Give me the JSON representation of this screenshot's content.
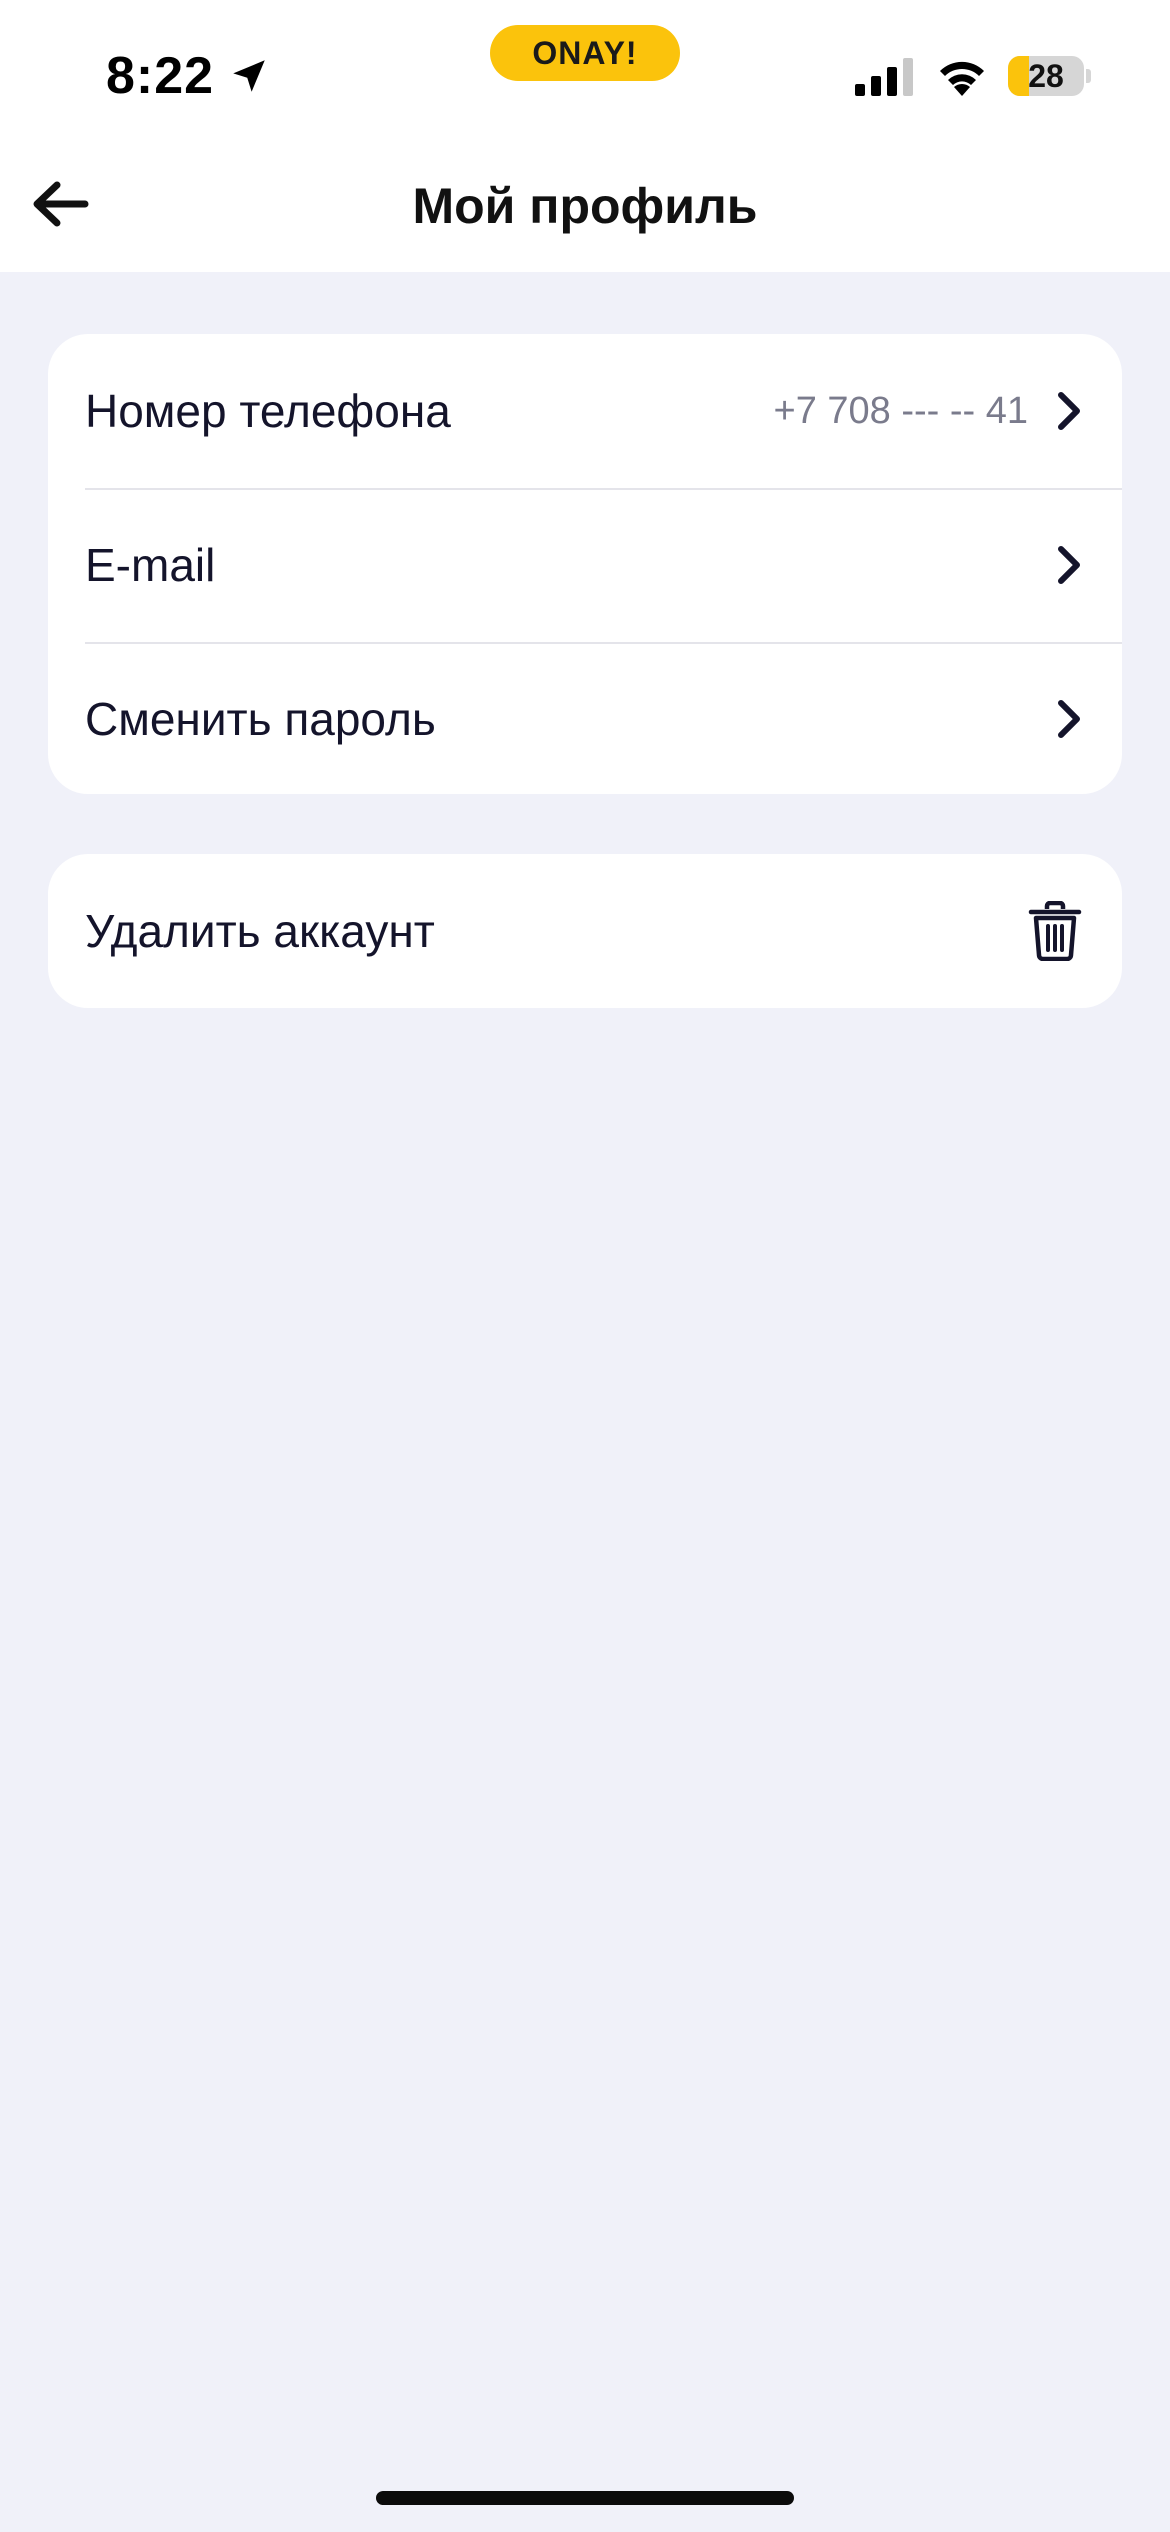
{
  "status_bar": {
    "time": "8:22",
    "location_icon": "location-arrow-icon",
    "pill_label": "ONAY!",
    "pill_color": "#fbc30c",
    "signal_icon": "cellular-signal-icon",
    "signal_bars_filled": 3,
    "signal_bars_total": 4,
    "wifi_icon": "wifi-icon",
    "battery_percent": "28",
    "battery_level": 0.28
  },
  "nav": {
    "back_icon": "arrow-left-icon",
    "title": "Мой профиль"
  },
  "profile_menu": {
    "items": [
      {
        "label": "Номер телефона",
        "value": "+7 708 --- -- 41",
        "icon": "chevron-right-icon"
      },
      {
        "label": "E-mail",
        "value": "",
        "icon": "chevron-right-icon"
      },
      {
        "label": "Сменить пароль",
        "value": "",
        "icon": "chevron-right-icon"
      }
    ]
  },
  "danger_menu": {
    "delete_label": "Удалить аккаунт",
    "delete_icon": "trash-icon"
  },
  "colors": {
    "background": "#f0f1f9",
    "card": "#ffffff",
    "text": "#14142b",
    "muted_text": "#7a7b8c",
    "accent": "#fbc30c"
  }
}
